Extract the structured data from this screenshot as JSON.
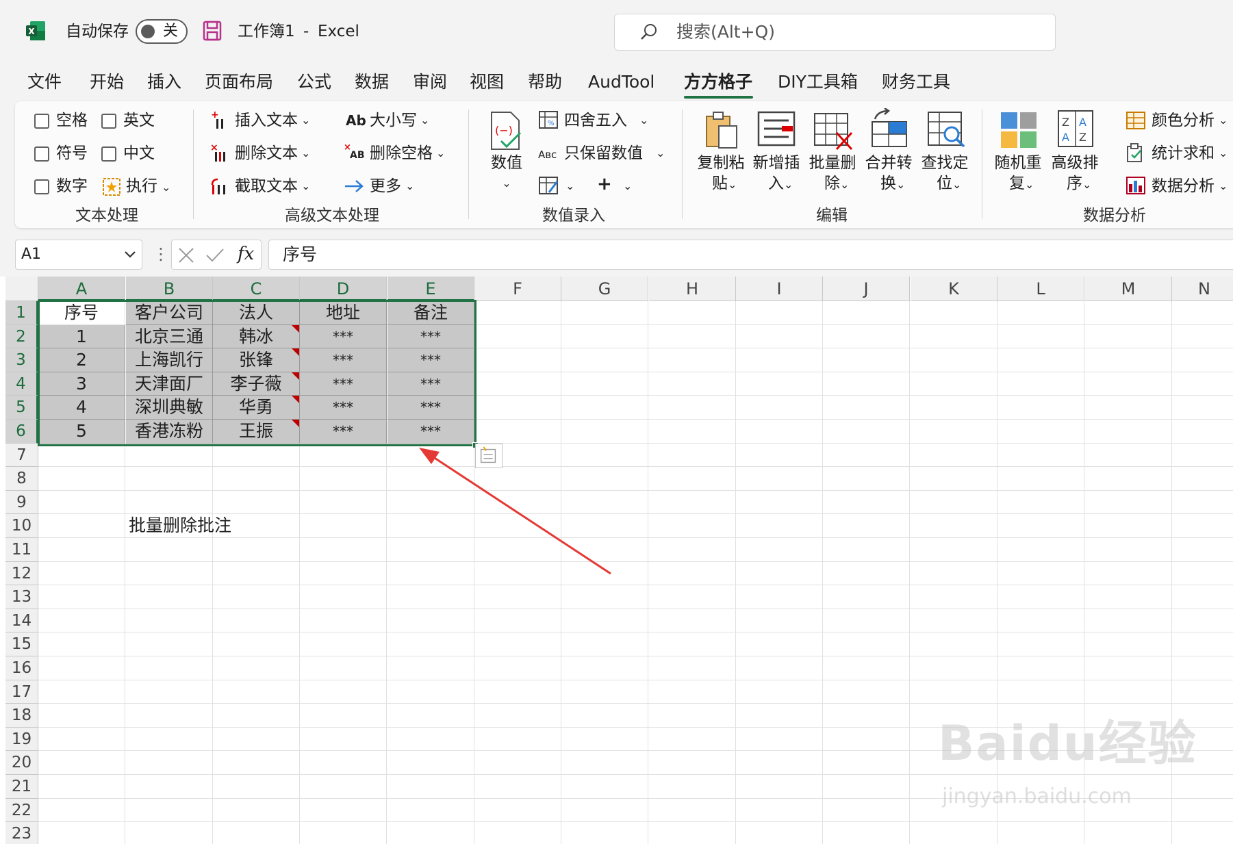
{
  "title_bar": {
    "autosave_label": "自动保存",
    "autosave_toggle": "关",
    "doc_title": "工作簿1",
    "separator": "-",
    "app_name": "Excel",
    "search_placeholder": "搜索(Alt+Q)"
  },
  "menu_tabs": [
    "文件",
    "开始",
    "插入",
    "页面布局",
    "公式",
    "数据",
    "审阅",
    "视图",
    "帮助",
    "AudTool",
    "方方格子",
    "DIY工具箱",
    "财务工具"
  ],
  "active_tab": "方方格子",
  "ribbon": {
    "text_processing": {
      "checkboxes": [
        "空格",
        "英文",
        "符号",
        "中文",
        "数字"
      ],
      "execute": "执行",
      "group_name": "文本处理"
    },
    "advanced_text": {
      "insert_text": "插入文本",
      "delete_text": "删除文本",
      "extract_text": "截取文本",
      "case": "大小写",
      "delete_space": "删除空格",
      "more": "更多",
      "group_name": "高级文本处理"
    },
    "value_entry": {
      "value": "数值",
      "round": "四舍五入",
      "keep_value": "只保留数值",
      "group_name": "数值录入"
    },
    "edit": {
      "copy_paste": [
        "复制粘",
        "贴"
      ],
      "new_insert": [
        "新增插",
        "入"
      ],
      "batch_delete": [
        "批量删",
        "除"
      ],
      "merge_convert": [
        "合并转",
        "换"
      ],
      "find_locate": [
        "查找定",
        "位"
      ],
      "group_name": "编辑"
    },
    "data_analysis": {
      "random_repeat": [
        "随机重",
        "复"
      ],
      "advanced_sort": [
        "高级排",
        "序"
      ],
      "color_analysis": "颜色分析",
      "stat_sum": "统计求和",
      "data_analysis": "数据分析",
      "group_name": "数据分析"
    }
  },
  "formula_bar": {
    "name_box": "A1",
    "fx": "fx",
    "value": "序号"
  },
  "columns": [
    "A",
    "B",
    "C",
    "D",
    "E",
    "F",
    "G",
    "H",
    "I",
    "J",
    "K",
    "L",
    "M",
    "N"
  ],
  "rows": [
    "1",
    "2",
    "3",
    "4",
    "5",
    "6",
    "7",
    "8",
    "9",
    "10",
    "11",
    "12",
    "13",
    "14",
    "15",
    "16",
    "17",
    "18",
    "19",
    "20",
    "21",
    "22",
    "23"
  ],
  "table": {
    "headers": [
      "序号",
      "客户公司",
      "法人",
      "地址",
      "备注"
    ],
    "rows": [
      [
        "1",
        "北京三通",
        "韩冰",
        "***",
        "***"
      ],
      [
        "2",
        "上海凯行",
        "张锋",
        "***",
        "***"
      ],
      [
        "3",
        "天津面厂",
        "李子薇",
        "***",
        "***"
      ],
      [
        "4",
        "深圳典敏",
        "华勇",
        "***",
        "***"
      ],
      [
        "5",
        "香港冻粉",
        "王振",
        "***",
        "***"
      ]
    ]
  },
  "note_cell": "批量删除批注",
  "watermark": {
    "brand": "Bai",
    "brand2": "du",
    "cn": "经验",
    "url": "jingyan.baidu.com"
  },
  "colors": {
    "accent": "#217346",
    "comment_marker": "#c00000",
    "arrow": "#e53935",
    "selection_fill": "#c8c8c8"
  }
}
